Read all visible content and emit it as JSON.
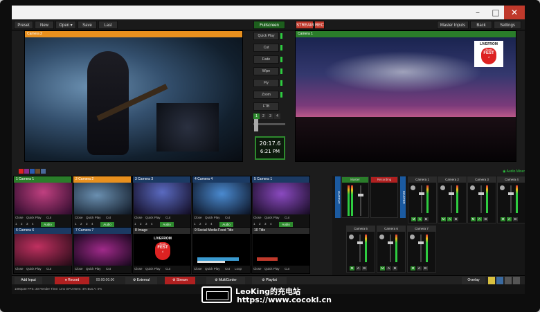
{
  "window": {
    "controls": [
      "–",
      "□",
      "✕"
    ]
  },
  "toolbar": {
    "left": [
      "Preset",
      "New",
      "Open",
      "Save",
      "Last"
    ],
    "open_arrow": "▾",
    "center": "Fullscreen",
    "stream": "STREAM",
    "rec": "REC",
    "right": [
      "Master Inputs",
      "Back",
      "Settings"
    ]
  },
  "preview": {
    "title": "Camera 2"
  },
  "program": {
    "title": "Camera 1",
    "logo_live": "LIVEFROM",
    "logo_rock": "Rock",
    "logo_fest": "FEST",
    "logo_num": "4"
  },
  "transitions": {
    "buttons": [
      "Quick Play",
      "Cut",
      "Fade",
      "Wipe",
      "Fly",
      "Zoom",
      "FTB"
    ],
    "pages": [
      "1",
      "2",
      "3",
      "4"
    ],
    "clock_time": "20:17.6",
    "clock_sub": "6:21 PM"
  },
  "inputs": [
    {
      "num": "1",
      "name": "Camera 1",
      "state": "pgm"
    },
    {
      "num": "2",
      "name": "Camera 2",
      "state": "pvw"
    },
    {
      "num": "3",
      "name": "Camera 3",
      "state": "normal"
    },
    {
      "num": "4",
      "name": "Camera 4",
      "state": "normal"
    },
    {
      "num": "5",
      "name": "Camera 1",
      "state": "normal"
    },
    {
      "num": "6",
      "name": "Camera 6",
      "state": "normal"
    },
    {
      "num": "7",
      "name": "Camera 7",
      "state": "normal"
    },
    {
      "num": "8",
      "name": "Image",
      "state": "normal"
    },
    {
      "num": "9",
      "name": "Social Media Feed Title",
      "state": "normal"
    },
    {
      "num": "10",
      "name": "Title",
      "state": "normal"
    }
  ],
  "input_controls": {
    "close": "Close",
    "quick_play": "Quick Play",
    "cut": "Cut",
    "loop": "Loop",
    "audio": "Audio",
    "nums": [
      "1",
      "2",
      "3",
      "4"
    ]
  },
  "mixer": {
    "title": "Audio Mixer",
    "master": "Master",
    "recording": "Recording",
    "output": "OUTPUT",
    "master_side": "MASTER",
    "channels": [
      "Camera 1",
      "Camera 2",
      "Camera 3",
      "Camera 4",
      "Camera 5",
      "Camera 6",
      "Camera 7"
    ],
    "m": "M",
    "a": "A",
    "b": "B"
  },
  "bottombar": {
    "add_input": "Add Input",
    "record": "Record",
    "record_time": "00:00:00.00",
    "external": "External",
    "stream": "Stream",
    "multicorder": "MultiCorder",
    "playlist": "Playlist",
    "overlay": "Overlay"
  },
  "status": {
    "text": "1080p30  FPS: 30  Render Time: 1ms  GPU Mem: 4%  Bus A: 0%"
  },
  "watermark": {
    "title": "LeoKing的充电站",
    "url": "https://www.cocokl.cn"
  },
  "colors": {
    "program": "#2a7d2a",
    "preview": "#e8901e",
    "stream": "#c0392b"
  }
}
